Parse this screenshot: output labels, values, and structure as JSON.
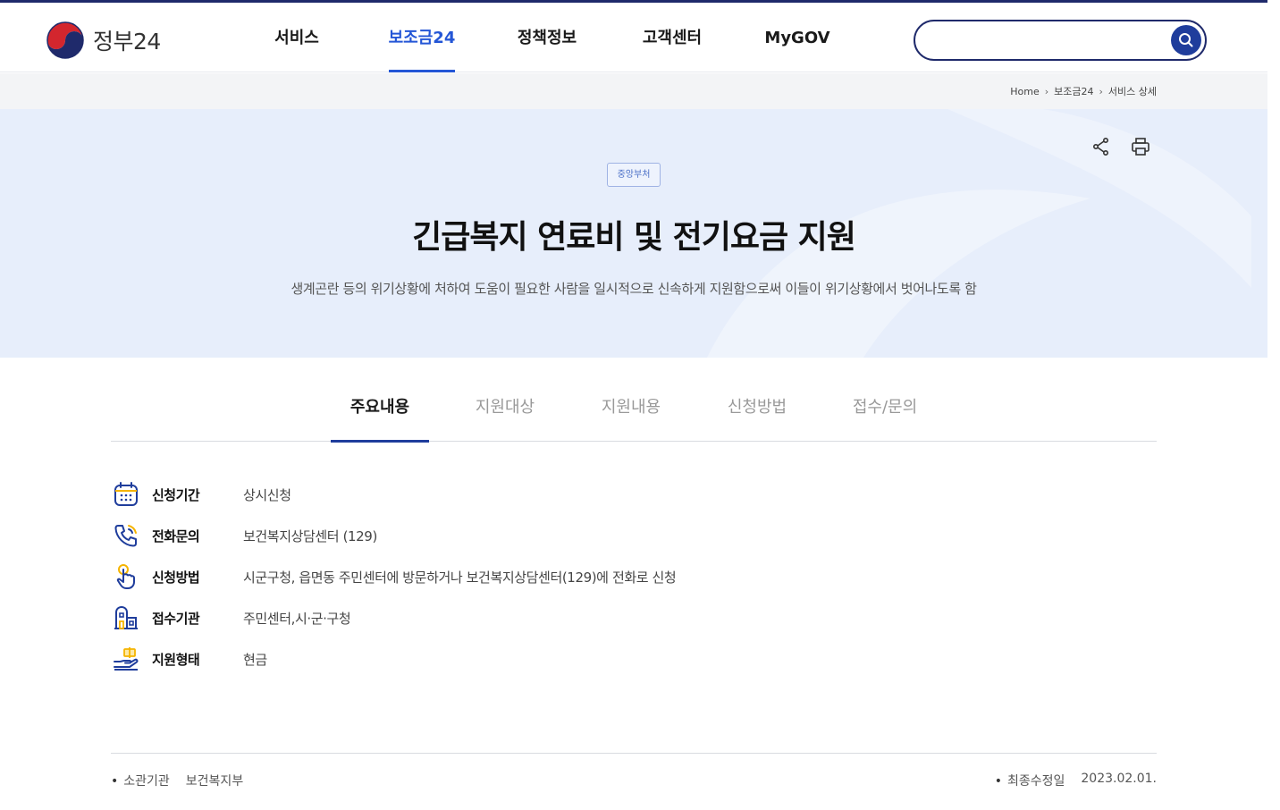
{
  "header": {
    "logo_text": "정부24",
    "nav": [
      {
        "label": "서비스"
      },
      {
        "label": "보조금24"
      },
      {
        "label": "정책정보"
      },
      {
        "label": "고객센터"
      },
      {
        "label": "MyGOV"
      }
    ],
    "active_nav": "보조금24",
    "search": {
      "value": "",
      "placeholder": ""
    }
  },
  "breadcrumb": [
    "Home",
    "보조금24",
    "서비스 상세"
  ],
  "hero": {
    "badge": "중앙부처",
    "title": "긴급복지 연료비 및 전기요금 지원",
    "description": "생계곤란 등의 위기상황에 처하여 도움이 필요한 사람을 일시적으로 신속하게 지원함으로써 이들이 위기상황에서 벗어나도록 함"
  },
  "tabs": [
    "주요내용",
    "지원대상",
    "지원내용",
    "신청방법",
    "접수/문의"
  ],
  "active_tab": "주요내용",
  "info": [
    {
      "icon": "calendar-icon",
      "label": "신청기간",
      "value": "상시신청"
    },
    {
      "icon": "phone-icon",
      "label": "전화문의",
      "value": "보건복지상담센터 (129)"
    },
    {
      "icon": "hand-pointer-icon",
      "label": "신청방법",
      "value": "시군구청, 읍면동 주민센터에 방문하거나 보건복지상담센터(129)에 전화로 신청"
    },
    {
      "icon": "building-icon",
      "label": "접수기관",
      "value": "주민센터,시·군·구청"
    },
    {
      "icon": "cash-hand-icon",
      "label": "지원형태",
      "value": "현금"
    }
  ],
  "footer": {
    "agency_label": "소관기관",
    "agency_value": "보건복지부",
    "updated_label": "최종수정일",
    "updated_value": "2023.02.01."
  },
  "colors": {
    "primary": "#1f3d9c",
    "accent": "#2456d6",
    "hero_bg": "#e7eefb"
  }
}
